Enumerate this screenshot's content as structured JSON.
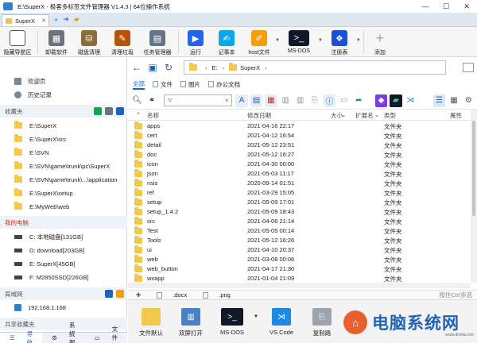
{
  "window": {
    "title": "E:\\SuperX - 极客多标签文件管理器 V1.4.3 | 64位操作系统"
  },
  "tabs": [
    {
      "label": "SuperX"
    }
  ],
  "toolbar": [
    {
      "label": "隐藏导航区",
      "icon": "hide-nav-icon",
      "color": "#4b5563"
    },
    {
      "label": "卸载软件",
      "icon": "uninstall-icon",
      "color": "#6b7280"
    },
    {
      "label": "磁盘清理",
      "icon": "disk-cleanup-icon",
      "color": "#8a6d3b"
    },
    {
      "label": "清理垃圾",
      "icon": "broom-icon",
      "color": "#b45309"
    },
    {
      "label": "任务管理器",
      "icon": "task-manager-icon",
      "color": "#64748b"
    },
    {
      "label": "运行",
      "icon": "run-icon",
      "color": "#2563eb"
    },
    {
      "label": "记事本",
      "icon": "notepad-icon",
      "color": "#0ea5e9"
    },
    {
      "label": "host文件",
      "icon": "host-file-icon",
      "color": "#f59e0b"
    },
    {
      "label": "MS-DOS",
      "icon": "msdos-icon",
      "color": "#111827"
    },
    {
      "label": "注册表",
      "icon": "registry-icon",
      "color": "#1d4ed8"
    },
    {
      "label": "添加",
      "icon": "plus-icon",
      "color": "#9ca3af"
    }
  ],
  "nav": {
    "top": [
      {
        "label": "欢迎页",
        "icon": "home-icon"
      },
      {
        "label": "历史记录",
        "icon": "history-icon"
      }
    ],
    "favorites_title": "收藏夹",
    "favorites": [
      "E:\\SuperX",
      "E:\\SuperX\\src",
      "E:\\SVN",
      "E:\\SVN\\game\\trunk\\pc\\SuperX",
      "E:\\SVN\\game\\trunk\\...\\application",
      "E:\\SuperX\\setup",
      "E:\\MyWeb\\web"
    ],
    "computer_title": "我的电脑",
    "drives": [
      "C: 本地磁盘[131GB]",
      "D: download[203GB]",
      "E: SuperX[45GB]",
      "F: M2850SSD[226GB]"
    ],
    "lan_title": "局域网",
    "lan": [
      "192.168.1.168"
    ],
    "shared_title": "共享收藏夹",
    "bottom_tabs": [
      "导航",
      "系统服务",
      "文件夹"
    ]
  },
  "address": {
    "parts": [
      "E:",
      "SuperX"
    ]
  },
  "filter_tabs": [
    "全部",
    "文件",
    "图片",
    "办公文档"
  ],
  "filter_placeholder": "",
  "columns": {
    "name": "名称",
    "modified": "修改日期",
    "size": "大小",
    "ext": "扩展名",
    "type": "类型",
    "attr": "属性"
  },
  "files": [
    {
      "name": "apps",
      "date": "2021-04-16 22:17",
      "type": "文件夹"
    },
    {
      "name": "cert",
      "date": "2021-04-12 16:54",
      "type": "文件夹"
    },
    {
      "name": "detail",
      "date": "2021-05-12 23:51",
      "type": "文件夹"
    },
    {
      "name": "doc",
      "date": "2021-05-12 16:27",
      "type": "文件夹"
    },
    {
      "name": "icon",
      "date": "2021-04-30 00:00",
      "type": "文件夹"
    },
    {
      "name": "json",
      "date": "2021-05-03 11:17",
      "type": "文件夹"
    },
    {
      "name": "nsis",
      "date": "2020-09-14 01:51",
      "type": "文件夹"
    },
    {
      "name": "ref",
      "date": "2021-03-29 15:05",
      "type": "文件夹"
    },
    {
      "name": "setup",
      "date": "2021-05-09 17:01",
      "type": "文件夹"
    },
    {
      "name": "setup_1.4.2",
      "date": "2021-05-09 18:43",
      "type": "文件夹"
    },
    {
      "name": "src",
      "date": "2021-04-06 21:14",
      "type": "文件夹"
    },
    {
      "name": "Test",
      "date": "2021-05-05 00:14",
      "type": "文件夹"
    },
    {
      "name": "Tools",
      "date": "2021-05-12 16:26",
      "type": "文件夹"
    },
    {
      "name": "ui",
      "date": "2021-04-10 20:37",
      "type": "文件夹"
    },
    {
      "name": "web",
      "date": "2021-03-08 00:06",
      "type": "文件夹"
    },
    {
      "name": "web_button",
      "date": "2021-04-17 21:30",
      "type": "文件夹"
    },
    {
      "name": "wxapp",
      "date": "2021-01-04 21:09",
      "type": "文件夹"
    }
  ],
  "ext_filters": [
    ".docx",
    ".png"
  ],
  "hint": "按住Ctrl多选",
  "quick": [
    {
      "label": "文件默认",
      "icon": "folder-icon",
      "color": "#f2c94c"
    },
    {
      "label": "双屏打开",
      "icon": "dual-pane-icon",
      "color": "#4b7fc4"
    },
    {
      "label": "MS-DOS",
      "icon": "msdos-icon",
      "color": "#111827"
    },
    {
      "label": "VS Code",
      "icon": "vscode-icon",
      "color": "#1e88e5"
    },
    {
      "label": "复制路",
      "icon": "copy-path-icon",
      "color": "#9ca3af"
    }
  ],
  "watermark": {
    "text": "电脑系统网",
    "sub": "www.dnxtw.com"
  },
  "colors": {
    "accent": "#1b63b8",
    "folder": "#f2c94c"
  }
}
